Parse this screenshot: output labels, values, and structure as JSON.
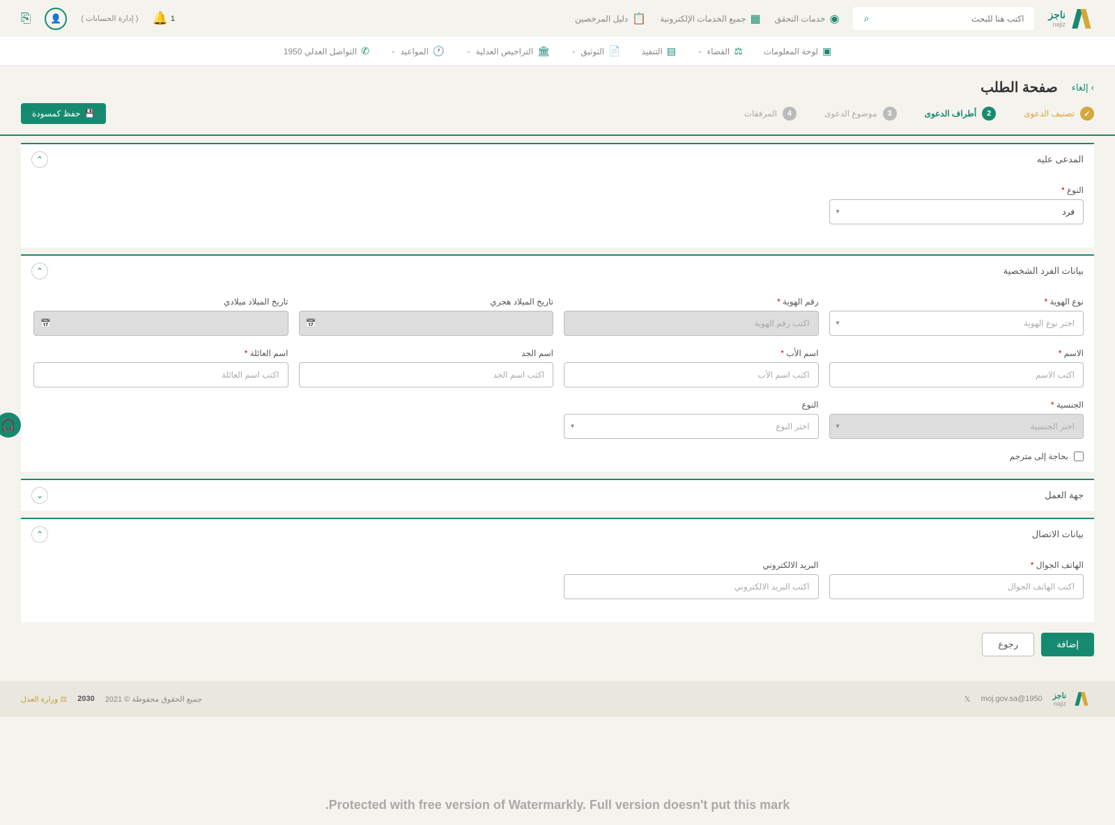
{
  "header": {
    "logo_text": "ناجز",
    "logo_sub": "najiz",
    "search_placeholder": "اكتب هنا للبحث",
    "links": {
      "verify": "خدمات التحقق",
      "services": "جميع الخدمات الإلكترونية",
      "licensed": "دليل المرخصين"
    },
    "bell_count": "1",
    "accounts": "( إدارة الحسابات )"
  },
  "nav": {
    "dashboard": "لوحة المعلومات",
    "judiciary": "القضاء",
    "execution": "التنفيذ",
    "documentation": "التوثيق",
    "licenses": "التراخيص العدلية",
    "appointments": "المواعيد",
    "contact": "التواصل العدلي 1950"
  },
  "page": {
    "cancel": "إلغاء",
    "title": "صفحة الطلب",
    "save_draft": "حفظ كمسودة"
  },
  "steps": {
    "s1": "تصنيف الدعوى",
    "s2": "أطراف الدعوى",
    "s3": "موضوع الدعوى",
    "s4": "المرفقات"
  },
  "sections": {
    "defendant": "المدعى عليه",
    "personal": "بيانات الفرد الشخصية",
    "employer": "جهة العمل",
    "contact": "بيانات الاتصال"
  },
  "form": {
    "type_label": "النوع",
    "type_value": "فرد",
    "id_type_label": "نوع الهوية",
    "id_type_placeholder": "اختر نوع الهوية",
    "id_number_label": "رقم الهوية",
    "id_number_placeholder": "اكتب رقم الهوية",
    "dob_hijri_label": "تاريخ الميلاد هجري",
    "dob_greg_label": "تاريخ الميلاد ميلادي",
    "name_label": "الاسم",
    "name_placeholder": "اكتب الاسم",
    "father_label": "اسم الأب",
    "father_placeholder": "اكتب اسم الأب",
    "grand_label": "اسم الجد",
    "grand_placeholder": "اكتب اسم الجد",
    "family_label": "اسم العائلة",
    "family_placeholder": "اكتب اسم العائلة",
    "nationality_label": "الجنسية",
    "nationality_placeholder": "اختر الجنسية",
    "gender_label": "النوع",
    "gender_placeholder": "اختر النوع",
    "translator": "بحاجة إلى مترجم",
    "mobile_label": "الهاتف الجوال",
    "mobile_placeholder": "اكتب الهاتف الجوال",
    "email_label": "البريد الالكتروني",
    "email_placeholder": "اكتب البريد الالكتروني"
  },
  "actions": {
    "add": "إضافة",
    "back": "رجوع"
  },
  "footer": {
    "email": "1950@moj.gov.sa",
    "copyright": "جميع الحقوق محفوظة © 2021",
    "vision": "2030",
    "watermark": "Protected with free version of Watermarkly. Full version doesn't put this mark."
  }
}
